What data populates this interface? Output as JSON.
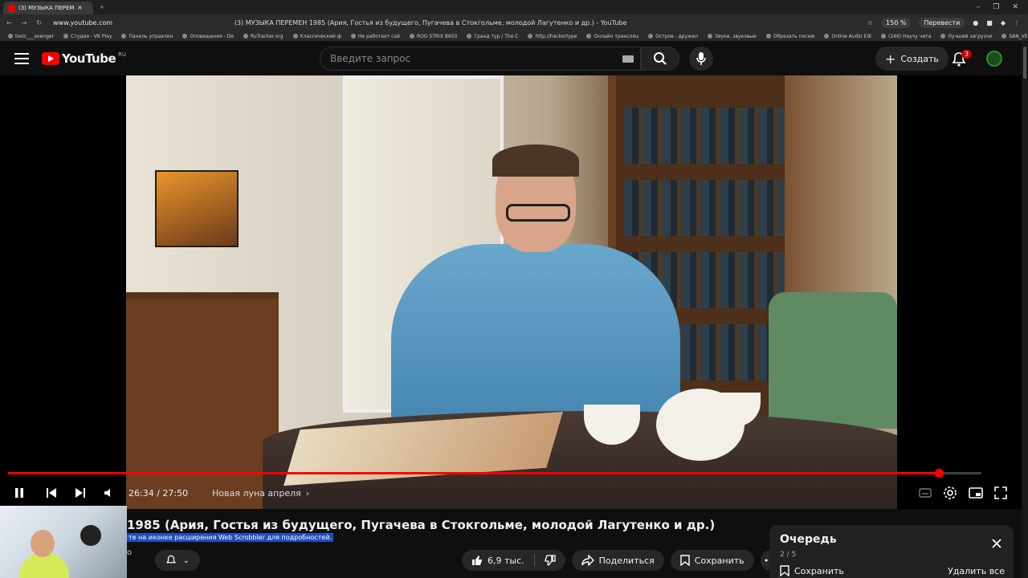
{
  "browser": {
    "tab_title": "(3) МУЗЫКА ПЕРЕМ",
    "url": "www.youtube.com",
    "page_title": "(3) МУЗЫКА ПЕРЕМЕН 1985 (Ария, Гостья из будущего, Пугачева в Стокгольме, молодой Лагутенко и др.) - YouTube",
    "zoom": "150 %",
    "translate_label": "Перевести",
    "bookmarks": [
      "toxic___avenger",
      "Студия - VK Play",
      "Панель управлен",
      "Оповещения - De",
      "RuTracker.org",
      "Классический ф",
      "Не работает сай",
      "ROG STRIX B650",
      "Гранд тур / The C",
      "http://hackertype",
      "Онлайн трансляц",
      "Остров - дружел",
      "Звуки, звуковые",
      "Обрезать песню",
      "Online Audio Edi",
      "(246) Научу чита",
      "Лучший загрузчи",
      "SAN_VENCI"
    ]
  },
  "masthead": {
    "logo_text": "YouTube",
    "region": "RU",
    "search_placeholder": "Введите запрос",
    "create_label": "Создать",
    "notification_count": "3"
  },
  "player": {
    "current_time": "26:34",
    "separator": "/",
    "duration": "27:50",
    "chapter": "Новая луна апреля",
    "progress_fraction": 0.956,
    "accent_color": "#ff0000"
  },
  "video": {
    "title": "1985 (Ария, Гостья из будущего, Пугачева в Стокгольме, молодой Лагутенко и др.)",
    "scrobbler_notice": "те на иконке расширения Web Scrobbler для подробностей.",
    "channel_fragment": "о",
    "like_count": "6,9 тыс.",
    "share_label": "Поделиться",
    "save_label": "Сохранить"
  },
  "queue": {
    "title": "Очередь",
    "count": "2 / 5",
    "save_label": "Сохранить",
    "delete_all_label": "Удалить все"
  }
}
